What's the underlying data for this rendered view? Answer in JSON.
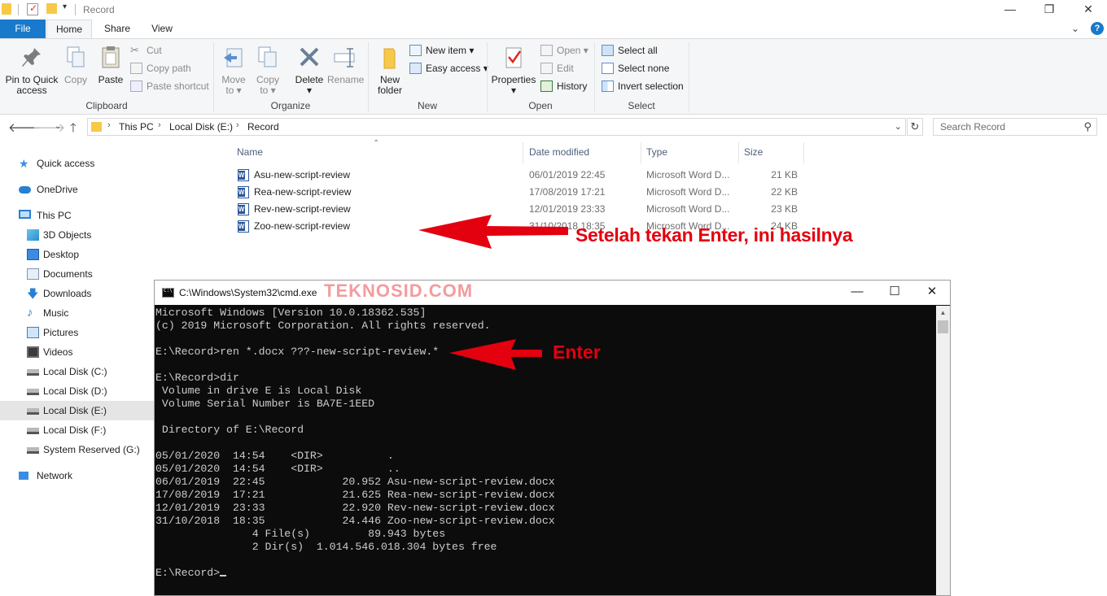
{
  "window": {
    "title": "Record",
    "minimize": "—",
    "maximize": "❐",
    "close": "✕"
  },
  "ribbon_tabs": [
    "File",
    "Home",
    "Share",
    "View"
  ],
  "ribbon": {
    "clipboard": {
      "label": "Clipboard",
      "pin": "Pin to Quick access",
      "pin_l1": "Pin to Quick",
      "pin_l2": "access",
      "copy": "Copy",
      "paste": "Paste",
      "cut": "Cut",
      "copy_path": "Copy path",
      "paste_shortcut": "Paste shortcut"
    },
    "organize": {
      "label": "Organize",
      "move_to_l1": "Move",
      "move_to_l2": "to",
      "copy_to_l1": "Copy",
      "copy_to_l2": "to",
      "delete": "Delete",
      "rename": "Rename"
    },
    "new": {
      "label": "New",
      "new_folder_l1": "New",
      "new_folder_l2": "folder",
      "new_item": "New item",
      "easy_access": "Easy access"
    },
    "open": {
      "label": "Open",
      "properties": "Properties",
      "open": "Open",
      "edit": "Edit",
      "history": "History"
    },
    "select": {
      "label": "Select",
      "select_all": "Select all",
      "select_none": "Select none",
      "invert_selection": "Invert selection"
    }
  },
  "address": {
    "crumbs": [
      "This PC",
      "Local Disk (E:)",
      "Record"
    ],
    "search_placeholder": "Search Record"
  },
  "nav_pane": [
    {
      "label": "Quick access",
      "icon": "star-icon"
    },
    {
      "label": "OneDrive",
      "icon": "cloud-icon"
    },
    {
      "label": "This PC",
      "icon": "computer-icon"
    },
    {
      "label": "3D Objects",
      "icon": "cube-icon"
    },
    {
      "label": "Desktop",
      "icon": "desktop-icon"
    },
    {
      "label": "Documents",
      "icon": "documents-icon"
    },
    {
      "label": "Downloads",
      "icon": "download-icon"
    },
    {
      "label": "Music",
      "icon": "music-icon"
    },
    {
      "label": "Pictures",
      "icon": "pictures-icon"
    },
    {
      "label": "Videos",
      "icon": "videos-icon"
    },
    {
      "label": "Local Disk (C:)",
      "icon": "drive-icon"
    },
    {
      "label": "Local Disk (D:)",
      "icon": "drive-icon"
    },
    {
      "label": "Local Disk (E:)",
      "icon": "drive-icon",
      "selected": true
    },
    {
      "label": "Local Disk (F:)",
      "icon": "drive-icon"
    },
    {
      "label": "System Reserved (G:)",
      "icon": "drive-icon"
    },
    {
      "label": "Network",
      "icon": "network-icon"
    }
  ],
  "file_list": {
    "columns": [
      "Name",
      "Date modified",
      "Type",
      "Size"
    ],
    "rows": [
      {
        "name": "Asu-new-script-review",
        "date": "06/01/2019 22:45",
        "type": "Microsoft Word D...",
        "size": "21 KB"
      },
      {
        "name": "Rea-new-script-review",
        "date": "17/08/2019 17:21",
        "type": "Microsoft Word D...",
        "size": "22 KB"
      },
      {
        "name": "Rev-new-script-review",
        "date": "12/01/2019 23:33",
        "type": "Microsoft Word D...",
        "size": "23 KB"
      },
      {
        "name": "Zoo-new-script-review",
        "date": "31/10/2018 18:35",
        "type": "Microsoft Word D...",
        "size": "24 KB"
      }
    ]
  },
  "annotations": {
    "result": "Setelah tekan Enter, ini hasilnya",
    "enter": "Enter",
    "watermark": "TEKNOSID.COM",
    "color": "#e3000f"
  },
  "cmd": {
    "title": "C:\\Windows\\System32\\cmd.exe",
    "lines": [
      "Microsoft Windows [Version 10.0.18362.535]",
      "(c) 2019 Microsoft Corporation. All rights reserved.",
      "",
      "E:\\Record>ren *.docx ???-new-script-review.*",
      "",
      "E:\\Record>dir",
      " Volume in drive E is Local Disk",
      " Volume Serial Number is BA7E-1EED",
      "",
      " Directory of E:\\Record",
      "",
      "05/01/2020  14:54    <DIR>          .",
      "05/01/2020  14:54    <DIR>          ..",
      "06/01/2019  22:45            20.952 Asu-new-script-review.docx",
      "17/08/2019  17:21            21.625 Rea-new-script-review.docx",
      "12/01/2019  23:33            22.920 Rev-new-script-review.docx",
      "31/10/2018  18:35            24.446 Zoo-new-script-review.docx",
      "               4 File(s)         89.943 bytes",
      "               2 Dir(s)  1.014.546.018.304 bytes free",
      "",
      "E:\\Record>"
    ]
  }
}
